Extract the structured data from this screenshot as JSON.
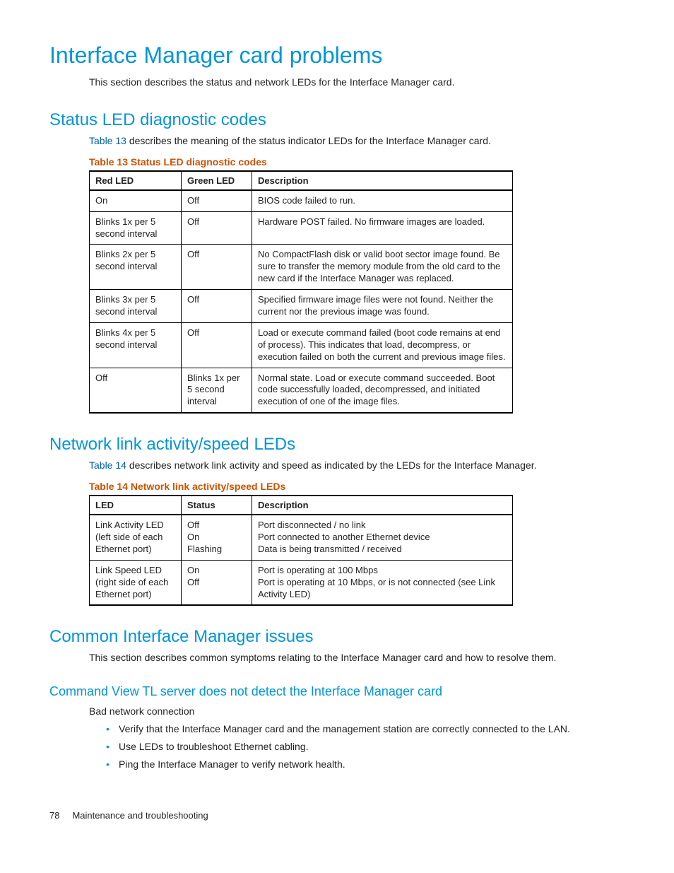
{
  "h1": "Interface Manager card problems",
  "intro": "This section describes the status and network LEDs for the Interface Manager card.",
  "h2a": "Status LED diagnostic codes",
  "s2a_lead_pre": "Table 13",
  "s2a_lead_post": " describes the meaning of the status indicator LEDs for the Interface Manager card.",
  "table13_caption": "Table 13 Status LED diagnostic codes",
  "table13": {
    "headers": {
      "c1": "Red LED",
      "c2": "Green LED",
      "c3": "Description"
    },
    "rows": [
      {
        "c1": "On",
        "c2": "Off",
        "c3": "BIOS code failed to run."
      },
      {
        "c1": "Blinks 1x per 5 second interval",
        "c2": "Off",
        "c3": "Hardware POST failed. No firmware images are loaded."
      },
      {
        "c1": "Blinks 2x per 5 second interval",
        "c2": "Off",
        "c3": "No CompactFlash disk or valid boot sector image found. Be sure to transfer the memory module from the old card to the new card if the Interface Manager was replaced."
      },
      {
        "c1": "Blinks 3x per 5 second interval",
        "c2": "Off",
        "c3": "Specified firmware image files were not found. Neither the current nor the previous image was found."
      },
      {
        "c1": "Blinks 4x per 5 second interval",
        "c2": "Off",
        "c3": "Load or execute command failed (boot code remains at end of process). This indicates that load, decompress, or execution failed on both the current and previous image files."
      },
      {
        "c1": "Off",
        "c2": "Blinks 1x per 5 second interval",
        "c3": "Normal state. Load or execute command succeeded. Boot code successfully loaded, decompressed, and initiated execution of one of the image files."
      }
    ]
  },
  "h2b": "Network link activity/speed LEDs",
  "s2b_lead_pre": "Table 14",
  "s2b_lead_post": " describes network link activity and speed as indicated by the LEDs for the Interface Manager.",
  "table14_caption": "Table 14 Network link activity/speed LEDs",
  "table14": {
    "headers": {
      "c1": "LED",
      "c2": "Status",
      "c3": "Description"
    },
    "rows": [
      {
        "c1": "Link Activity LED (left side of each Ethernet port)",
        "c2": "Off\nOn\nFlashing",
        "c3": "Port disconnected / no link\nPort connected to another Ethernet device\nData is being transmitted / received"
      },
      {
        "c1": "Link Speed LED (right side of each Ethernet port)",
        "c2": "On\nOff",
        "c3": "Port is operating at 100 Mbps\nPort is operating at 10 Mbps, or is not connected (see Link Activity LED)"
      }
    ]
  },
  "h2c": "Common Interface Manager issues",
  "s2c_body": "This section describes common symptoms relating to the Interface Manager card and how to resolve them.",
  "h3a": "Command View TL server does not detect the Interface Manager card",
  "bad_conn_label": "Bad network connection",
  "bullets": [
    "Verify that the Interface Manager card and the management station are correctly connected to the LAN.",
    "Use LEDs to troubleshoot Ethernet cabling.",
    "Ping the Interface Manager to verify network health."
  ],
  "footer": {
    "page": "78",
    "section": "Maintenance and troubleshooting"
  }
}
